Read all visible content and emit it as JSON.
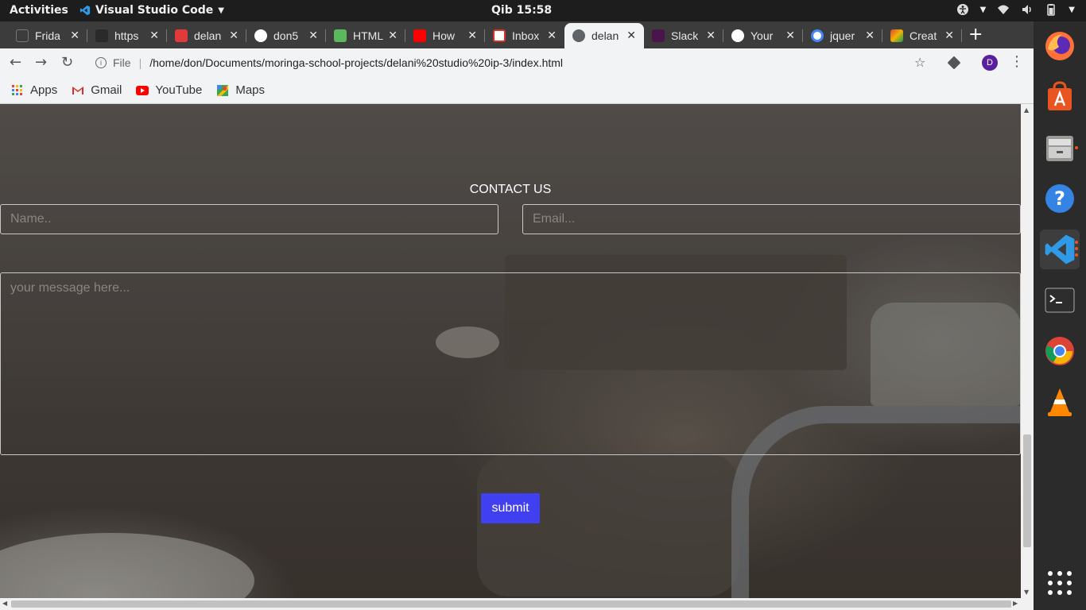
{
  "topbar": {
    "activities": "Activities",
    "app_name": "Visual Studio Code",
    "clock": "Qib 15:58"
  },
  "tabs": [
    {
      "title": "Frida",
      "favicon_color": "#3c3c3c",
      "active": false
    },
    {
      "title": "https",
      "favicon_color": "#3c3c3c",
      "active": false
    },
    {
      "title": "delan",
      "favicon_color": "#e03a3a",
      "active": false
    },
    {
      "title": "don5",
      "favicon_color": "#ffffff",
      "active": false
    },
    {
      "title": "HTML",
      "favicon_color": "#5cb85c",
      "active": false
    },
    {
      "title": "How",
      "favicon_color": "#ff0000",
      "active": false
    },
    {
      "title": "Inbox",
      "favicon_color": "#d93025",
      "active": false
    },
    {
      "title": "delan",
      "favicon_color": "#5f6368",
      "active": true
    },
    {
      "title": "Slack",
      "favicon_color": "#4a154b",
      "active": false
    },
    {
      "title": "Your",
      "favicon_color": "#ffffff",
      "active": false
    },
    {
      "title": "jquer",
      "favicon_color": "#4285f4",
      "active": false
    },
    {
      "title": "Creat",
      "favicon_color": "#f4b400",
      "active": false
    }
  ],
  "omnibox": {
    "scheme_label": "File",
    "url": "/home/don/Documents/moringa-school-projects/delani%20studio%20ip-3/index.html"
  },
  "profile_initial": "D",
  "bookmarks": [
    {
      "label": "Apps",
      "icon": "apps-grid-icon"
    },
    {
      "label": "Gmail",
      "icon": "gmail-icon"
    },
    {
      "label": "YouTube",
      "icon": "youtube-icon"
    },
    {
      "label": "Maps",
      "icon": "maps-icon"
    }
  ],
  "contact": {
    "title": "CONTACT US",
    "name_placeholder": "Name..",
    "email_placeholder": "Email...",
    "message_placeholder": "your message here...",
    "submit_label": "submit"
  },
  "dock": [
    {
      "name": "firefox-icon"
    },
    {
      "name": "software-center-icon"
    },
    {
      "name": "files-icon"
    },
    {
      "name": "help-icon"
    },
    {
      "name": "vscode-icon"
    },
    {
      "name": "terminal-icon"
    },
    {
      "name": "chrome-icon"
    },
    {
      "name": "vlc-icon"
    },
    {
      "name": "show-apps-icon"
    }
  ],
  "colors": {
    "submit_bg": "#4040f0",
    "topbar_bg": "#1d1d1d",
    "tabstrip_bg": "#3c3c3c"
  }
}
